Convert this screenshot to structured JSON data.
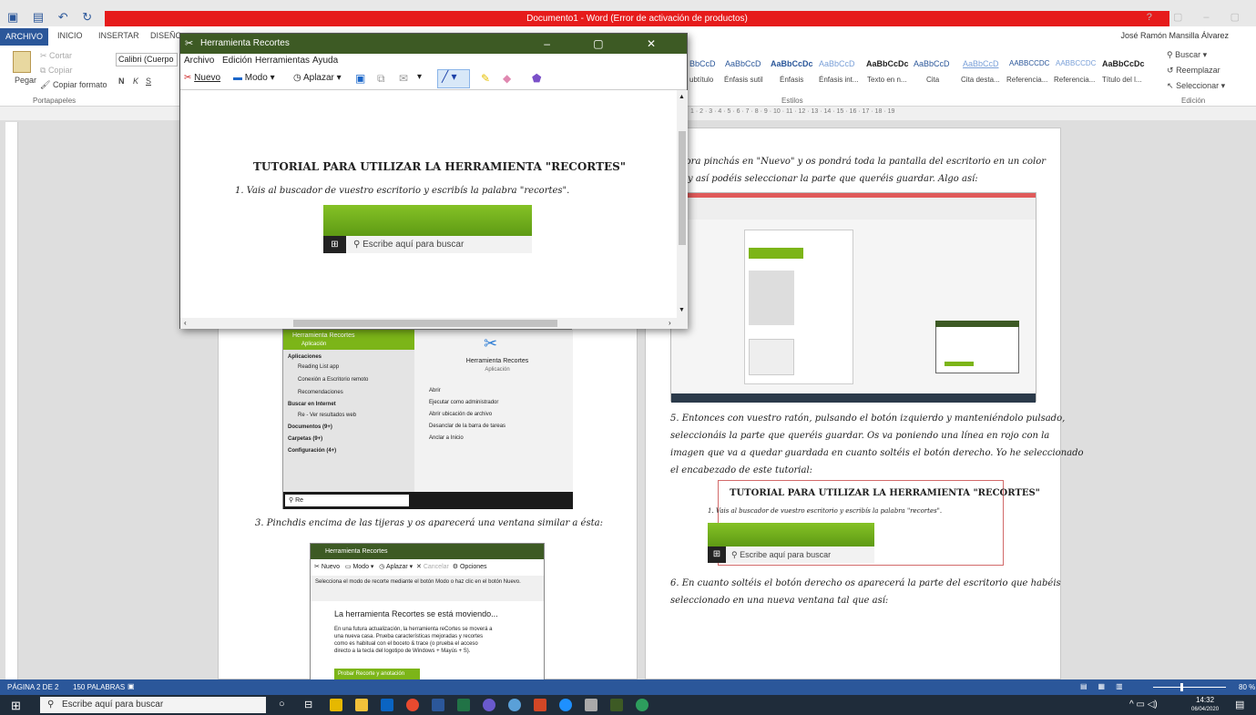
{
  "word": {
    "title": "Documento1 - Word (Error de activación de productos)",
    "tabs": [
      "ARCHIVO",
      "INICIO",
      "INSERTAR",
      "DISEÑO"
    ],
    "user": "José Ramón Mansilla Álvarez",
    "clipboard": {
      "paste": "Pegar",
      "cut": "Cortar",
      "copy": "Copiar",
      "format": "Copiar formato",
      "label": "Portapapeles"
    },
    "font": {
      "name": "Calibri (Cuerpo",
      "bold": "N",
      "italic": "K",
      "underline": "S"
    },
    "styles": {
      "samples": [
        "BbCcD",
        "AaBbCcD",
        "AaBbCcDc",
        "AaBbCcD",
        "AaBbCcDc",
        "AaBbCcD",
        "AaBbCcD",
        "AABBCCDC",
        "AABBCCDC",
        "AaBbCcDc"
      ],
      "names": [
        "ubtítulo",
        "Énfasis sutil",
        "Énfasis",
        "Énfasis int...",
        "Texto en n...",
        "Cita",
        "Cita desta...",
        "Referencia...",
        "Referencia...",
        "Título del l..."
      ],
      "label": "Estilos"
    },
    "editing": {
      "find": "Buscar",
      "replace": "Reemplazar",
      "select": "Seleccionar",
      "label": "Edición"
    },
    "ruler": "1 · 2 · 3 · 4 · 5 · 6 · 7 · 8 · 9 · 10 · 11 · 12 · 13 · 14 · 15 · 16 · 17 · 18 · 19",
    "status": {
      "page": "PÁGINA 2 DE 2",
      "words": "150 PALABRAS",
      "zoom": "80 %"
    }
  },
  "doc": {
    "right_p1": "Ahora pinchás en \"Nuevo\" y os pondrá toda la pantalla del escritorio en un color",
    "right_p2": "y así podéis seleccionar la parte que queréis guardar. Algo así:",
    "step5_1": "5. Entonces con vuestro ratón, pulsando el botón izquierdo y manteniéndolo pulsado,",
    "step5_2": "seleccionáis la parte que queréis guardar. Os va poniendo una línea en rojo con la",
    "step5_3": "imagen que va a quedar guardada en cuanto soltéis el botón derecho. Yo he seleccionado",
    "step5_4": "el encabezado de este tutorial:",
    "inset_title": "TUTORIAL PARA UTILIZAR LA HERRAMIENTA \"RECORTES\"",
    "inset_step": "1. Vais al buscador de vuestro escritorio y escribís la palabra \"recortes\".",
    "inset_search": "Escribe aquí para buscar",
    "step6_1": "6. En cuanto soltéis el botón derecho os aparecerá la parte del escritorio que habéis",
    "step6_2": "seleccionado en una nueva ventana tal que así:",
    "step3": "3. Pinchdis encima de las tijeras y os aparecerá una ventana similar a ésta:",
    "startmenu": {
      "top": "Herramienta Recortes",
      "top_sub": "Aplicación",
      "apps_hdr": "Aplicaciones",
      "apps": [
        "Reading List app",
        "Conexión a Escritorio remoto",
        "Recomendaciones"
      ],
      "web_hdr": "Buscar en Internet",
      "web": "Re - Ver resultados web",
      "docs": "Documentos (9+)",
      "folders": "Carpetas (9+)",
      "config": "Configuración (4+)",
      "right_title": "Herramienta Recortes",
      "right_sub": "Aplicación",
      "actions": [
        "Abrir",
        "Ejecutar como administrador",
        "Abrir ubicación de archivo",
        "Desanclar de la barra de tareas",
        "Anclar a Inicio"
      ],
      "query": "Re"
    },
    "snip2": {
      "title": "Herramienta Recortes",
      "tools": [
        "Nuevo",
        "Modo",
        "Aplazar",
        "Cancelar",
        "Opciones"
      ],
      "msg": "Selecciona el modo de recorte mediante el botón Modo o haz clic en el botón Nuevo.",
      "move_title": "La herramienta Recortes se está moviendo...",
      "move_text": "En una futura actualización, la herramienta reCortes se moverá a una nueva casa. Prueba características mejoradas y recortes como es habitual con el boceto & trace (o prueba el acceso directo a la tecla del logotipo de Windows + Mayús + S).",
      "button": "Probar Recorte y anotación"
    }
  },
  "snip": {
    "title": "Herramienta Recortes",
    "menu": [
      "Archivo",
      "Edición",
      "Herramientas",
      "Ayuda"
    ],
    "tools": [
      "Nuevo",
      "Modo",
      "Aplazar"
    ],
    "heading": "TUTORIAL PARA UTILIZAR LA HERRAMIENTA \"RECORTES\"",
    "step1": "1. Vais al buscador de vuestro escritorio y escribís la palabra \"recortes\".",
    "search": "Escribe aquí para buscar"
  },
  "taskbar": {
    "search": "Escribe aquí para buscar",
    "time": "14:32",
    "date": "06/04/2020"
  },
  "colors": {
    "word_blue": "#2b579a",
    "title_red": "#e61b1b",
    "snip_green": "#3d5a24",
    "win_green": "#7cb518"
  }
}
